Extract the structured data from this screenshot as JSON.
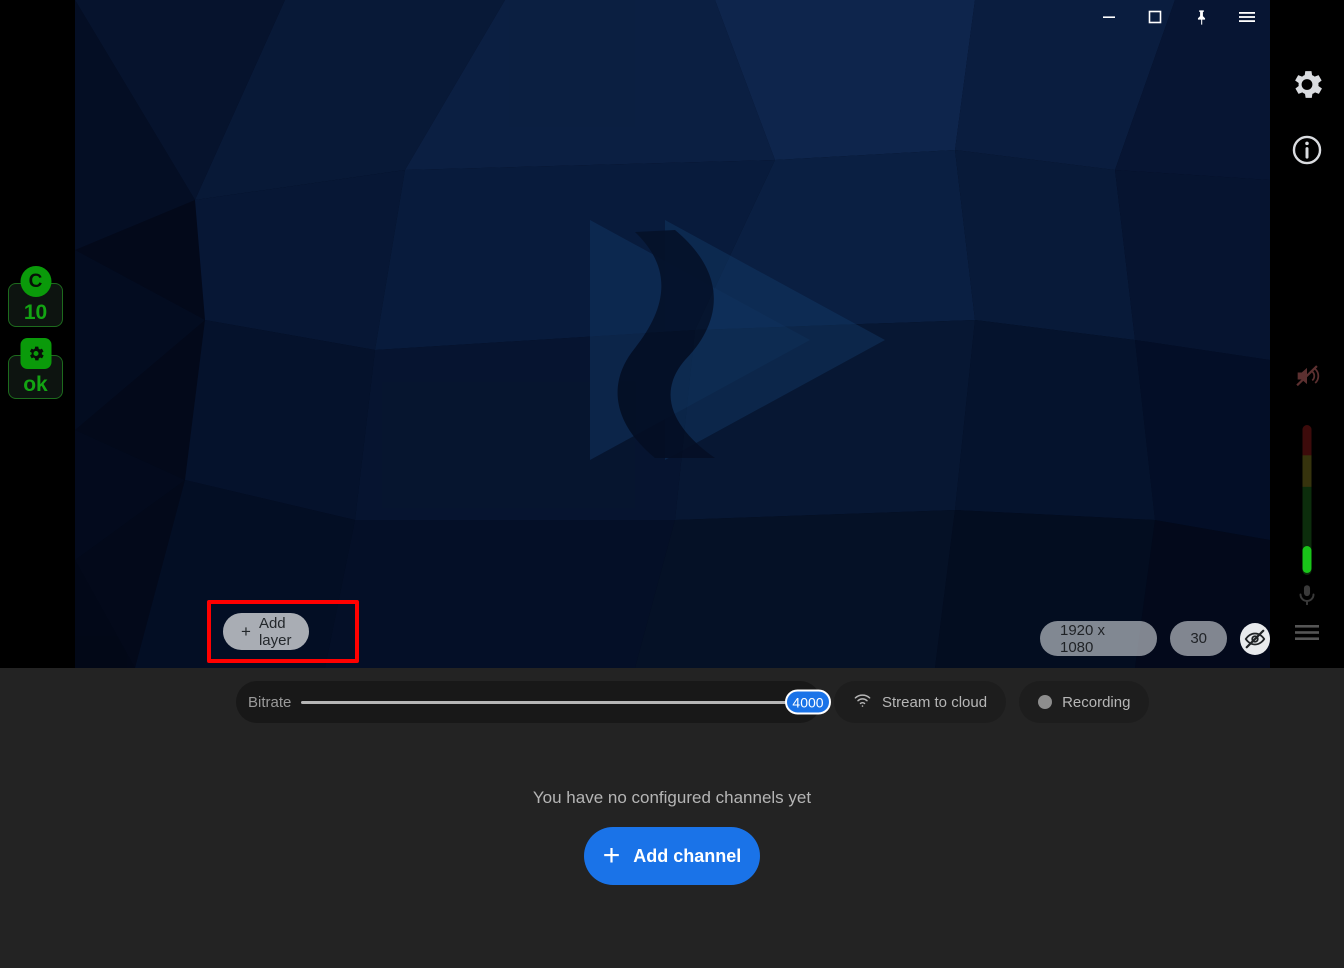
{
  "window": {
    "controls": [
      {
        "name": "minimize",
        "glyph": "—"
      },
      {
        "name": "maximize",
        "glyph": "□"
      },
      {
        "name": "pin",
        "glyph": "📌"
      },
      {
        "name": "menu",
        "glyph": "☰"
      },
      {
        "name": "close",
        "glyph": "✕"
      }
    ]
  },
  "status_badges": [
    {
      "icon_label": "C",
      "value": "10",
      "name": "cpu-badge"
    },
    {
      "icon_label": "gear",
      "value": "ok",
      "name": "status-badge"
    }
  ],
  "right_toolbar": {
    "settings_label": "settings-icon",
    "info_label": "info-icon",
    "speaker_muted_label": "speaker-muted-icon",
    "microphone_label": "microphone-icon",
    "menu_label": "menu-icon",
    "meter_level_percent": 18
  },
  "preview": {
    "add_layer_label": "Add layer",
    "add_layer_plus": "+",
    "resolution": "1920 x 1080",
    "framerate": "30",
    "visibility_icon": "eye-off-icon",
    "highlight_color": "#ff0000"
  },
  "toolbar": {
    "bitrate_label": "Bitrate",
    "bitrate_value": "4000",
    "stream_label": "Stream to cloud",
    "recording_label": "Recording"
  },
  "empty_state": {
    "message": "You have no configured channels yet",
    "add_channel_label": "Add channel",
    "add_channel_plus": "+"
  },
  "colors": {
    "accent_blue": "#1a73e8",
    "highlight_red": "#ff0000",
    "status_green": "#0a9a0a",
    "panel_dark": "#232323"
  }
}
